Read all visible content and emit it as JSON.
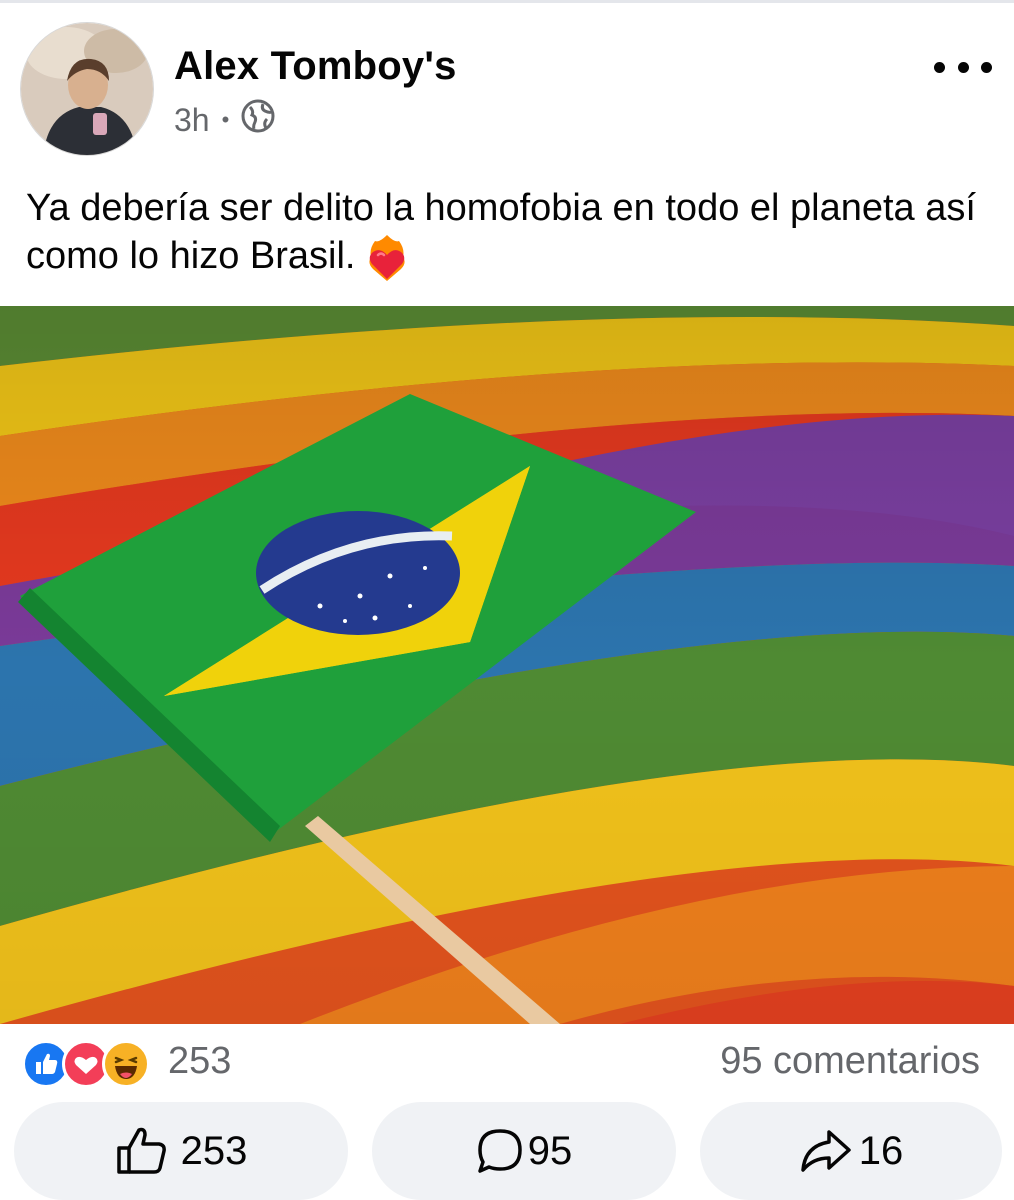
{
  "post": {
    "author": "Alex Tomboy's",
    "time": "3h",
    "audience_icon": "globe-icon",
    "text": "Ya debería ser delito la homofobia en todo el planeta así como lo hizo Brasil.",
    "text_emoji": "heart-on-fire-emoji"
  },
  "reactions": {
    "icons": [
      "like-reaction-icon",
      "love-reaction-icon",
      "haha-reaction-icon"
    ],
    "count": "253",
    "comments": "95 comentarios"
  },
  "actions": {
    "like": "253",
    "comment": "95",
    "share": "16"
  },
  "colors": {
    "like_blue": "#1877f2",
    "love_red": "#f33e58",
    "haha_yellow": "#f7b125",
    "secondary_text": "#65676b",
    "button_bg": "#f0f2f5"
  }
}
